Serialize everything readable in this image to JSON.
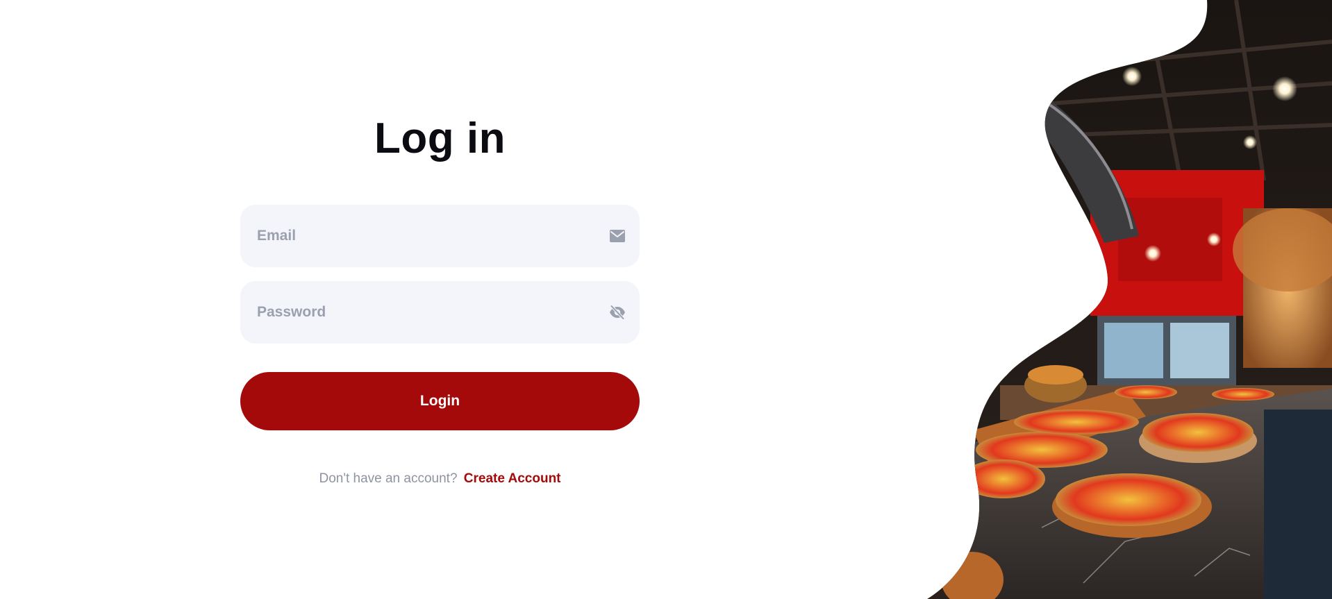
{
  "login": {
    "title": "Log in",
    "email_placeholder": "Email",
    "password_placeholder": "Password",
    "login_label": "Login",
    "signup_prompt": "Don't have an account?",
    "create_account_label": "Create Account"
  },
  "icons": {
    "email": "mail-icon",
    "password": "eye-off-icon"
  },
  "colors": {
    "accent": "#a50a0a",
    "field_background": "#f4f5fa",
    "placeholder": "#9aa0ae",
    "title": "#0b0b12",
    "muted_text": "#8e93a1"
  }
}
